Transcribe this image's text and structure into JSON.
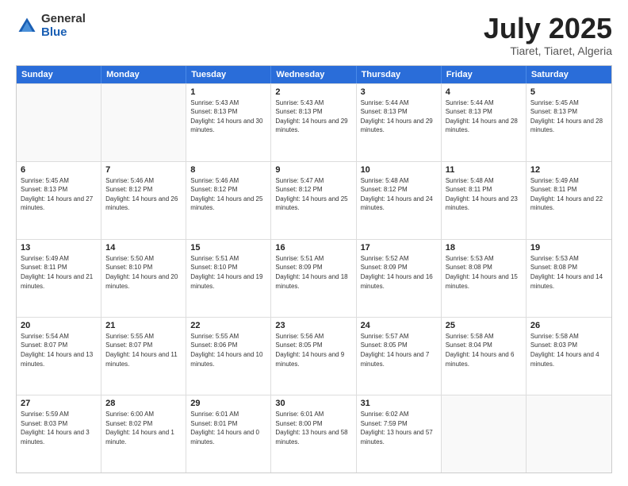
{
  "logo": {
    "general": "General",
    "blue": "Blue"
  },
  "header": {
    "title": "July 2025",
    "subtitle": "Tiaret, Tiaret, Algeria"
  },
  "weekdays": [
    "Sunday",
    "Monday",
    "Tuesday",
    "Wednesday",
    "Thursday",
    "Friday",
    "Saturday"
  ],
  "rows": [
    [
      {
        "day": "",
        "sunrise": "",
        "sunset": "",
        "daylight": ""
      },
      {
        "day": "",
        "sunrise": "",
        "sunset": "",
        "daylight": ""
      },
      {
        "day": "1",
        "sunrise": "Sunrise: 5:43 AM",
        "sunset": "Sunset: 8:13 PM",
        "daylight": "Daylight: 14 hours and 30 minutes."
      },
      {
        "day": "2",
        "sunrise": "Sunrise: 5:43 AM",
        "sunset": "Sunset: 8:13 PM",
        "daylight": "Daylight: 14 hours and 29 minutes."
      },
      {
        "day": "3",
        "sunrise": "Sunrise: 5:44 AM",
        "sunset": "Sunset: 8:13 PM",
        "daylight": "Daylight: 14 hours and 29 minutes."
      },
      {
        "day": "4",
        "sunrise": "Sunrise: 5:44 AM",
        "sunset": "Sunset: 8:13 PM",
        "daylight": "Daylight: 14 hours and 28 minutes."
      },
      {
        "day": "5",
        "sunrise": "Sunrise: 5:45 AM",
        "sunset": "Sunset: 8:13 PM",
        "daylight": "Daylight: 14 hours and 28 minutes."
      }
    ],
    [
      {
        "day": "6",
        "sunrise": "Sunrise: 5:45 AM",
        "sunset": "Sunset: 8:13 PM",
        "daylight": "Daylight: 14 hours and 27 minutes."
      },
      {
        "day": "7",
        "sunrise": "Sunrise: 5:46 AM",
        "sunset": "Sunset: 8:12 PM",
        "daylight": "Daylight: 14 hours and 26 minutes."
      },
      {
        "day": "8",
        "sunrise": "Sunrise: 5:46 AM",
        "sunset": "Sunset: 8:12 PM",
        "daylight": "Daylight: 14 hours and 25 minutes."
      },
      {
        "day": "9",
        "sunrise": "Sunrise: 5:47 AM",
        "sunset": "Sunset: 8:12 PM",
        "daylight": "Daylight: 14 hours and 25 minutes."
      },
      {
        "day": "10",
        "sunrise": "Sunrise: 5:48 AM",
        "sunset": "Sunset: 8:12 PM",
        "daylight": "Daylight: 14 hours and 24 minutes."
      },
      {
        "day": "11",
        "sunrise": "Sunrise: 5:48 AM",
        "sunset": "Sunset: 8:11 PM",
        "daylight": "Daylight: 14 hours and 23 minutes."
      },
      {
        "day": "12",
        "sunrise": "Sunrise: 5:49 AM",
        "sunset": "Sunset: 8:11 PM",
        "daylight": "Daylight: 14 hours and 22 minutes."
      }
    ],
    [
      {
        "day": "13",
        "sunrise": "Sunrise: 5:49 AM",
        "sunset": "Sunset: 8:11 PM",
        "daylight": "Daylight: 14 hours and 21 minutes."
      },
      {
        "day": "14",
        "sunrise": "Sunrise: 5:50 AM",
        "sunset": "Sunset: 8:10 PM",
        "daylight": "Daylight: 14 hours and 20 minutes."
      },
      {
        "day": "15",
        "sunrise": "Sunrise: 5:51 AM",
        "sunset": "Sunset: 8:10 PM",
        "daylight": "Daylight: 14 hours and 19 minutes."
      },
      {
        "day": "16",
        "sunrise": "Sunrise: 5:51 AM",
        "sunset": "Sunset: 8:09 PM",
        "daylight": "Daylight: 14 hours and 18 minutes."
      },
      {
        "day": "17",
        "sunrise": "Sunrise: 5:52 AM",
        "sunset": "Sunset: 8:09 PM",
        "daylight": "Daylight: 14 hours and 16 minutes."
      },
      {
        "day": "18",
        "sunrise": "Sunrise: 5:53 AM",
        "sunset": "Sunset: 8:08 PM",
        "daylight": "Daylight: 14 hours and 15 minutes."
      },
      {
        "day": "19",
        "sunrise": "Sunrise: 5:53 AM",
        "sunset": "Sunset: 8:08 PM",
        "daylight": "Daylight: 14 hours and 14 minutes."
      }
    ],
    [
      {
        "day": "20",
        "sunrise": "Sunrise: 5:54 AM",
        "sunset": "Sunset: 8:07 PM",
        "daylight": "Daylight: 14 hours and 13 minutes."
      },
      {
        "day": "21",
        "sunrise": "Sunrise: 5:55 AM",
        "sunset": "Sunset: 8:07 PM",
        "daylight": "Daylight: 14 hours and 11 minutes."
      },
      {
        "day": "22",
        "sunrise": "Sunrise: 5:55 AM",
        "sunset": "Sunset: 8:06 PM",
        "daylight": "Daylight: 14 hours and 10 minutes."
      },
      {
        "day": "23",
        "sunrise": "Sunrise: 5:56 AM",
        "sunset": "Sunset: 8:05 PM",
        "daylight": "Daylight: 14 hours and 9 minutes."
      },
      {
        "day": "24",
        "sunrise": "Sunrise: 5:57 AM",
        "sunset": "Sunset: 8:05 PM",
        "daylight": "Daylight: 14 hours and 7 minutes."
      },
      {
        "day": "25",
        "sunrise": "Sunrise: 5:58 AM",
        "sunset": "Sunset: 8:04 PM",
        "daylight": "Daylight: 14 hours and 6 minutes."
      },
      {
        "day": "26",
        "sunrise": "Sunrise: 5:58 AM",
        "sunset": "Sunset: 8:03 PM",
        "daylight": "Daylight: 14 hours and 4 minutes."
      }
    ],
    [
      {
        "day": "27",
        "sunrise": "Sunrise: 5:59 AM",
        "sunset": "Sunset: 8:03 PM",
        "daylight": "Daylight: 14 hours and 3 minutes."
      },
      {
        "day": "28",
        "sunrise": "Sunrise: 6:00 AM",
        "sunset": "Sunset: 8:02 PM",
        "daylight": "Daylight: 14 hours and 1 minute."
      },
      {
        "day": "29",
        "sunrise": "Sunrise: 6:01 AM",
        "sunset": "Sunset: 8:01 PM",
        "daylight": "Daylight: 14 hours and 0 minutes."
      },
      {
        "day": "30",
        "sunrise": "Sunrise: 6:01 AM",
        "sunset": "Sunset: 8:00 PM",
        "daylight": "Daylight: 13 hours and 58 minutes."
      },
      {
        "day": "31",
        "sunrise": "Sunrise: 6:02 AM",
        "sunset": "Sunset: 7:59 PM",
        "daylight": "Daylight: 13 hours and 57 minutes."
      },
      {
        "day": "",
        "sunrise": "",
        "sunset": "",
        "daylight": ""
      },
      {
        "day": "",
        "sunrise": "",
        "sunset": "",
        "daylight": ""
      }
    ]
  ]
}
